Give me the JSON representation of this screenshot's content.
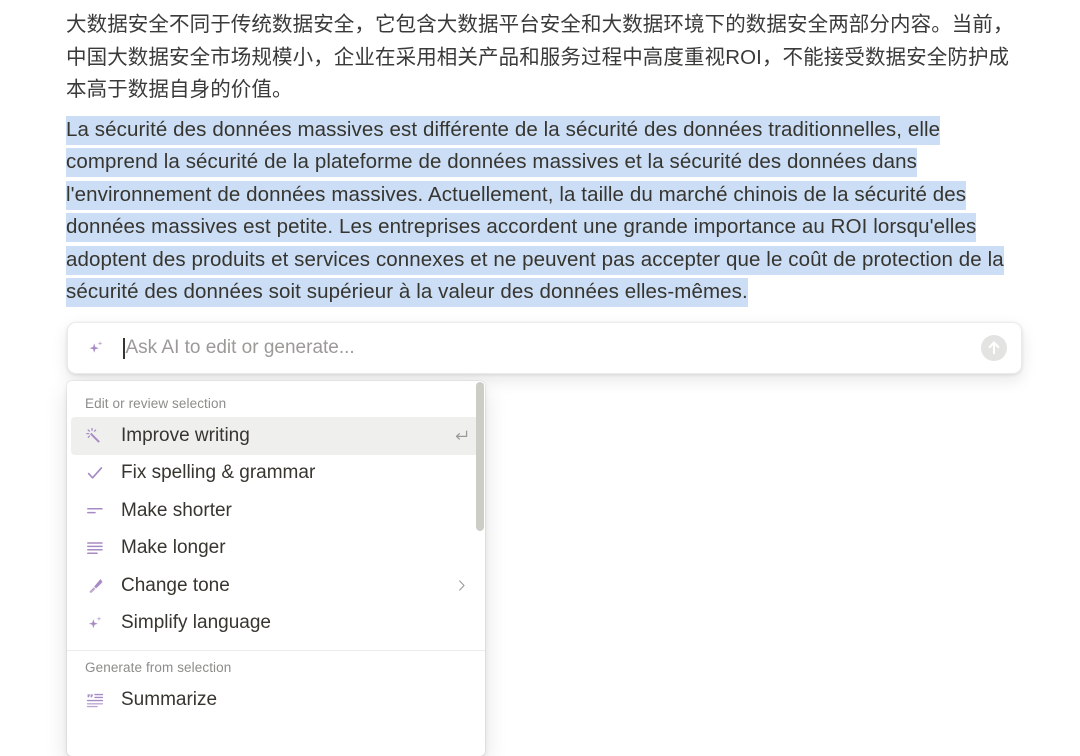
{
  "document": {
    "paragraph_cn": "大数据安全不同于传统数据安全，它包含大数据平台安全和大数据环境下的数据安全两部分内容。当前，中国大数据安全市场规模小，企业在采用相关产品和服务过程中高度重视ROI，不能接受数据安全防护成本高于数据自身的价值。",
    "paragraph_fr_selected": "La sécurité des données massives est différente de la sécurité des données traditionnelles, elle comprend la sécurité de la plateforme de données massives et la sécurité des données dans l'environnement de données massives. Actuellement, la taille du marché chinois de la sécurité des données massives est petite. Les entreprises accordent une grande importance au ROI lorsqu'elles adoptent des produits et services connexes et ne peuvent pas accepter que le coût de protection de la sécurité des données soit supérieur à la valeur des données elles-mêmes.",
    "selection_color": "#cbdef5"
  },
  "ai_bar": {
    "placeholder": "Ask AI to edit or generate...",
    "value": "",
    "leading_icon": "sparkle-icon",
    "submit_icon": "arrow-up-circle-icon",
    "accent_color": "#a78bc4"
  },
  "menu": {
    "sections": [
      {
        "label": "Edit or review selection",
        "items": [
          {
            "label": "Improve writing",
            "icon": "magic-wand-sparkle-icon",
            "active": true,
            "shortcut": "return-arrow-icon",
            "submenu": false
          },
          {
            "label": "Fix spelling & grammar",
            "icon": "check-icon",
            "active": false,
            "shortcut": "",
            "submenu": false
          },
          {
            "label": "Make shorter",
            "icon": "make-shorter-lines-icon",
            "active": false,
            "shortcut": "",
            "submenu": false
          },
          {
            "label": "Make longer",
            "icon": "make-longer-lines-icon",
            "active": false,
            "shortcut": "",
            "submenu": false
          },
          {
            "label": "Change tone",
            "icon": "pen-brush-icon",
            "active": false,
            "shortcut": "",
            "submenu": true
          },
          {
            "label": "Simplify language",
            "icon": "sparkle-icon",
            "active": false,
            "shortcut": "",
            "submenu": false
          }
        ]
      },
      {
        "label": "Generate from selection",
        "items": [
          {
            "label": "Summarize",
            "icon": "quote-lines-icon",
            "active": false,
            "shortcut": "",
            "submenu": false
          }
        ]
      }
    ],
    "icon_color": "#a78bc4",
    "highlight_color": "#efefee",
    "scrollbar": {
      "thumb_color": "#cdcdc7"
    }
  }
}
